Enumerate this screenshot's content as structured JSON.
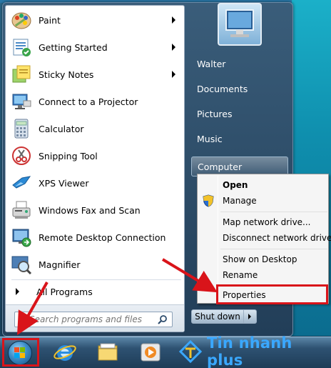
{
  "programs": [
    {
      "label": "Paint",
      "icon": "paint-icon",
      "submenu": true
    },
    {
      "label": "Getting Started",
      "icon": "getting-started-icon",
      "submenu": true
    },
    {
      "label": "Sticky Notes",
      "icon": "sticky-notes-icon",
      "submenu": true
    },
    {
      "label": "Connect to a Projector",
      "icon": "projector-icon",
      "submenu": false
    },
    {
      "label": "Calculator",
      "icon": "calculator-icon",
      "submenu": false
    },
    {
      "label": "Snipping Tool",
      "icon": "scissors-icon",
      "submenu": false
    },
    {
      "label": "XPS Viewer",
      "icon": "xps-viewer-icon",
      "submenu": false
    },
    {
      "label": "Windows Fax and Scan",
      "icon": "fax-icon",
      "submenu": false
    },
    {
      "label": "Remote Desktop Connection",
      "icon": "remote-desktop-icon",
      "submenu": false
    },
    {
      "label": "Magnifier",
      "icon": "magnifier-icon",
      "submenu": false
    }
  ],
  "all_programs": "All Programs",
  "search": {
    "placeholder": "Search programs and files"
  },
  "right_panel": {
    "items": [
      "Walter",
      "Documents",
      "Pictures",
      "Music",
      "Computer"
    ],
    "highlighted": "Computer"
  },
  "shutdown": {
    "label": "Shut down"
  },
  "context_menu": {
    "items": [
      {
        "label": "Open",
        "bold": true
      },
      {
        "label": "Manage",
        "bold": false,
        "icon": "shield-icon"
      },
      {
        "label": "Map network drive...",
        "bold": false
      },
      {
        "label": "Disconnect network drive...",
        "bold": false
      },
      {
        "label": "Show on Desktop",
        "bold": false
      },
      {
        "label": "Rename",
        "bold": false
      },
      {
        "label": "Properties",
        "bold": false
      }
    ],
    "highlighted": "Properties"
  },
  "taskbar": {
    "icons": [
      "start-orb-icon",
      "internet-explorer-icon",
      "file-explorer-icon",
      "media-player-icon"
    ]
  },
  "watermark": {
    "text": "Tin nhanh plus"
  },
  "colors": {
    "annotation": "#d9141a",
    "watermark": "#3aa8ff",
    "menu_dark": "#223e58"
  }
}
